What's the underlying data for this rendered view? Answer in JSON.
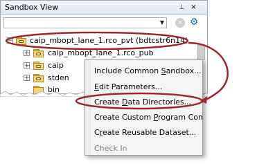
{
  "panel": {
    "title": "Sandbox View",
    "title_icons": [
      "pin-icon",
      "close-icon"
    ],
    "filter": {
      "value": "",
      "placeholder": ""
    },
    "toolbar_icons": [
      "dropdown-icon",
      "clear-icon",
      "settings-icon"
    ]
  },
  "tree": [
    {
      "label": "caip_mbopt_lane_1.rco_pvt (bdtcstr6n14)",
      "icon": "sandbox-folder-icon",
      "expander": "−"
    },
    {
      "label": "caip_mbopt_lane_1.rco_pub",
      "icon": "sandbox-folder-icon",
      "expander": "+"
    },
    {
      "label": "caip",
      "icon": "sandbox-folder-icon",
      "expander": "+"
    },
    {
      "label": "stden",
      "icon": "sandbox-folder-icon",
      "expander": "+"
    },
    {
      "label": "bin",
      "icon": "folder-icon",
      "expander": ""
    }
  ],
  "context_menu": {
    "items": [
      {
        "before": "Include Common ",
        "mnemonic": "S",
        "after": "andbox..."
      },
      {
        "before": "",
        "mnemonic": "E",
        "after": "dit Parameters..."
      },
      {
        "before": "Create ",
        "mnemonic": "D",
        "after": "ata Directories..."
      },
      {
        "before": "Create Custom ",
        "mnemonic": "P",
        "after": "rogram Component"
      },
      {
        "before": "C",
        "mnemonic": "r",
        "after": "eate Reusable Dataset..."
      },
      {
        "before": "",
        "mnemonic": "",
        "after": "Check In"
      }
    ],
    "highlighted_index": 2
  },
  "annotation": {
    "color": "#a0252b"
  },
  "colors": {
    "folder": "#f3d37a",
    "accent": "#1f6fc5"
  }
}
